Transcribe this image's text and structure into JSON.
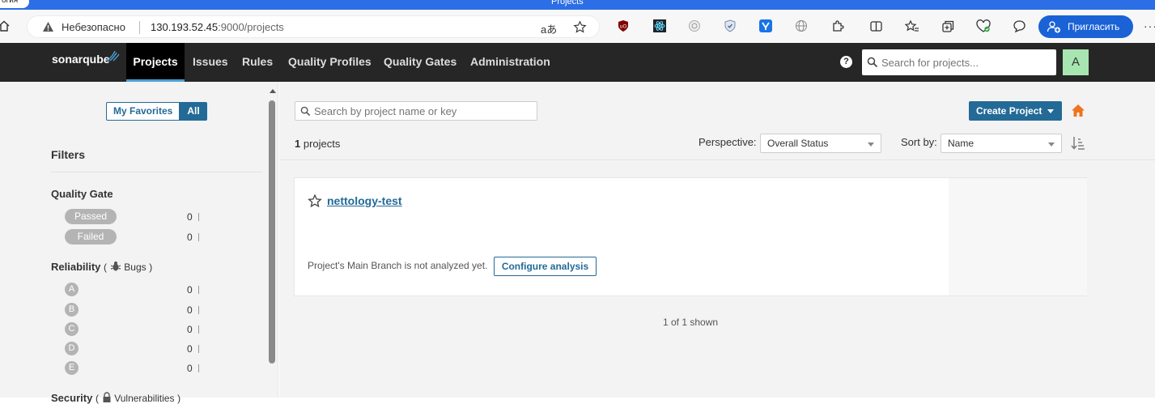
{
  "browser": {
    "tab_stub_text": "огия",
    "window_title": "Projects",
    "insecure_label": "Небезопасно",
    "url_host": "130.193.52.45",
    "url_rest": ":9000/projects",
    "invite_label": "Пригласить",
    "more_label": "···"
  },
  "nav": {
    "logo": "sonarqube",
    "items": [
      {
        "label": "Projects"
      },
      {
        "label": "Issues"
      },
      {
        "label": "Rules"
      },
      {
        "label": "Quality Profiles"
      },
      {
        "label": "Quality Gates"
      },
      {
        "label": "Administration"
      }
    ],
    "help": "?",
    "search_placeholder": "Search for projects...",
    "avatar": "A"
  },
  "sidebar": {
    "my_favorites": "My Favorites",
    "all": "All",
    "filters_title": "Filters",
    "quality_gate": {
      "title": "Quality Gate",
      "options": [
        {
          "label": "Passed",
          "count": "0"
        },
        {
          "label": "Failed",
          "count": "0"
        }
      ]
    },
    "reliability": {
      "title": "Reliability",
      "paren_open": "(",
      "metric": "Bugs",
      "paren_close": ")",
      "ratings": [
        {
          "label": "A",
          "count": "0"
        },
        {
          "label": "B",
          "count": "0"
        },
        {
          "label": "C",
          "count": "0"
        },
        {
          "label": "D",
          "count": "0"
        },
        {
          "label": "E",
          "count": "0"
        }
      ]
    },
    "security": {
      "title": "Security",
      "paren_open": "(",
      "metric": "Vulnerabilities",
      "paren_close": ")"
    }
  },
  "main": {
    "search_placeholder": "Search by project name or key",
    "create_project": "Create Project",
    "project_count": "1",
    "project_count_suffix": " projects",
    "perspective_label": "Perspective:",
    "perspective_value": "Overall Status",
    "sort_label": "Sort by:",
    "sort_value": "Name",
    "project": {
      "name": "nettology-test",
      "status_text": "Project's Main Branch is not analyzed yet.",
      "configure_label": "Configure analysis"
    },
    "shown_text": "1 of 1 shown"
  },
  "colors": {
    "nav_bg": "#262626",
    "accent": "#236a97",
    "browser_blue": "#2b6ee6",
    "home_orange": "#f0731e"
  }
}
